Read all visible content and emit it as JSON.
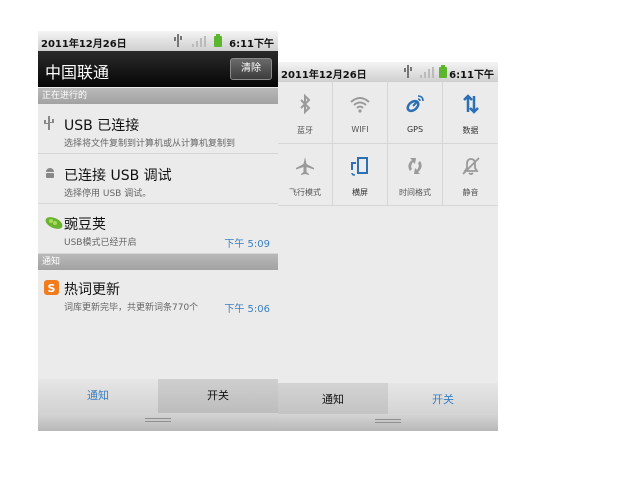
{
  "left_phone": {
    "status": {
      "date": "2011年12月26日",
      "time": "6:11下午"
    },
    "header": {
      "carrier": "中国联通",
      "clear_label": "清除"
    },
    "ongoing_section": "正在进行的",
    "ongoing_items": [
      {
        "title": "USB 已连接",
        "subtitle": "选择将文件复制到计算机或从计算机复制到",
        "time": "",
        "icon": "usb-icon"
      },
      {
        "title": "已连接 USB 调试",
        "subtitle": "选择停用 USB 调试。",
        "time": "",
        "icon": "android-icon"
      },
      {
        "title": "豌豆荚",
        "subtitle": "USB模式已经开启",
        "time": "下午 5:09",
        "icon": "pea-pod-icon"
      }
    ],
    "notify_section": "通知",
    "notify_items": [
      {
        "title": "热词更新",
        "subtitle": "词库更新完毕，共更新词条770个",
        "time": "下午 5:06",
        "icon": "sogou-icon"
      }
    ],
    "tabs": {
      "notifications": "通知",
      "switches": "开关"
    }
  },
  "right_phone": {
    "status": {
      "date": "2011年12月26日",
      "time": "6:11下午"
    },
    "toggles": [
      {
        "label": "蓝牙",
        "icon": "bluetooth-icon",
        "on": false
      },
      {
        "label": "WIFI",
        "icon": "wifi-icon",
        "on": false
      },
      {
        "label": "GPS",
        "icon": "gps-icon",
        "on": true
      },
      {
        "label": "数据",
        "icon": "data-icon",
        "on": true
      },
      {
        "label": "飞行模式",
        "icon": "airplane-icon",
        "on": false
      },
      {
        "label": "横屏",
        "icon": "rotate-screen-icon",
        "on": true
      },
      {
        "label": "时间格式",
        "icon": "time-format-icon",
        "on": false
      },
      {
        "label": "静音",
        "icon": "mute-icon",
        "on": false
      }
    ],
    "tabs": {
      "notifications": "通知",
      "switches": "开关"
    }
  },
  "colors": {
    "accent_blue": "#3a7fc1",
    "active_icon": "#2c6fb4",
    "inactive_icon": "#9a9a9a"
  }
}
